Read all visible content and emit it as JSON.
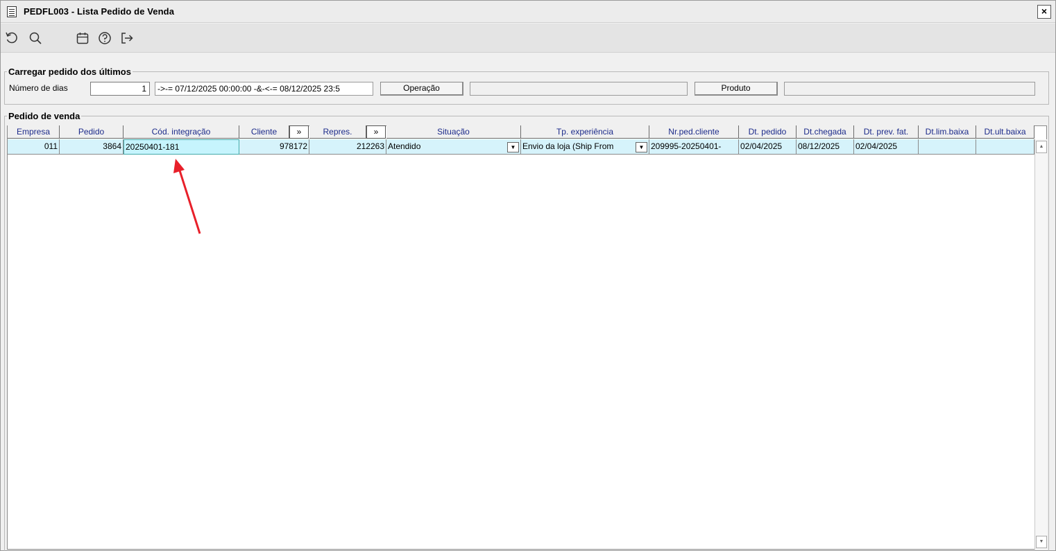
{
  "window": {
    "title": "PEDFL003 - Lista Pedido de Venda",
    "close_label": "×"
  },
  "toolbar": {
    "icons": [
      "refresh-icon",
      "search-icon",
      "calendar-icon",
      "help-icon",
      "exit-icon"
    ]
  },
  "load_filter": {
    "legend": "Carregar pedido dos últimos",
    "days_label": "Número de dias",
    "days_value": "1",
    "range_text": "->-= 07/12/2025 00:00:00 -&-<-= 08/12/2025 23:5",
    "operation_button": "Operação",
    "operation_value": "",
    "product_button": "Produto",
    "product_value": ""
  },
  "orders": {
    "legend": "Pedido de venda",
    "expand_label": "»",
    "columns": [
      "Empresa",
      "Pedido",
      "Cód. integração",
      "Cliente",
      "Repres.",
      "Situação",
      "Tp. experiência",
      "Nr.ped.cliente",
      "Dt. pedido",
      "Dt.chegada",
      "Dt. prev. fat.",
      "Dt.lim.baixa",
      "Dt.ult.baixa"
    ],
    "rows": [
      {
        "empresa": "011",
        "pedido": "3864",
        "cod_integracao": "20250401-181",
        "cliente": "978172",
        "repres": "212263",
        "situacao": "Atendido",
        "tp_experiencia": "Envio da loja (Ship From",
        "nr_ped_cliente": "209995-20250401-",
        "dt_pedido": "02/04/2025",
        "dt_chegada": "08/12/2025",
        "dt_prev_fat": "02/04/2025",
        "dt_lim_baixa": "",
        "dt_ult_baixa": ""
      }
    ]
  },
  "colors": {
    "row_bg": "#d6f3fb",
    "header_text": "#1b2a8a",
    "annotation_arrow": "#e8202a"
  }
}
